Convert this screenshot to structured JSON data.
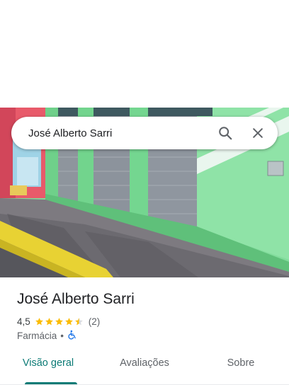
{
  "search": {
    "query": "José Alberto Sarri"
  },
  "icons": {
    "search": "search-icon",
    "close": "close-icon",
    "accessibility": "wheelchair-icon",
    "star": "star-icon"
  },
  "place": {
    "name": "José Alberto Sarri",
    "rating": "4,5",
    "rating_value": 4.5,
    "stars_max": 5,
    "review_count": "(2)",
    "category": "Farmácia",
    "separator": "•"
  },
  "tabs": [
    {
      "label": "Visão geral",
      "active": true
    },
    {
      "label": "Avaliações",
      "active": false
    },
    {
      "label": "Sobre",
      "active": false
    }
  ],
  "colors": {
    "accent": "#0b7a75",
    "star": "#fbbc04",
    "accessibility": "#1a73e8"
  }
}
